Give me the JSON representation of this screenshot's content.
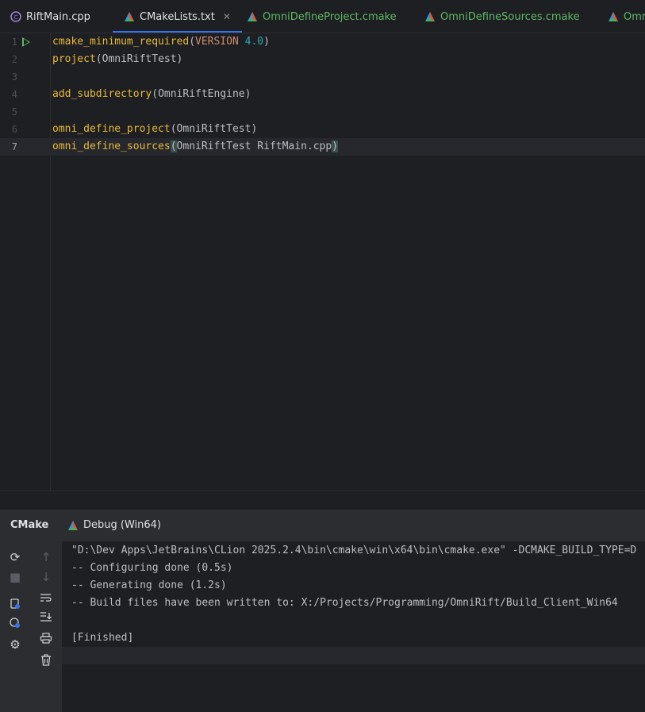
{
  "tabs": [
    {
      "label": "RiftMain.cpp",
      "icon": "cpp-file-icon",
      "active": false
    },
    {
      "label": "CMakeLists.txt",
      "icon": "cmake-file-icon",
      "active": true
    },
    {
      "label": "OmniDefineProject.cmake",
      "icon": "cmake-file-icon",
      "active": false
    },
    {
      "label": "OmniDefineSources.cmake",
      "icon": "cmake-file-icon",
      "active": false
    },
    {
      "label": "Omni",
      "icon": "cmake-file-icon",
      "active": false
    }
  ],
  "editor": {
    "lines": [
      {
        "num": "1",
        "fn": "cmake_minimum_required",
        "open": "(",
        "kw": "VERSION",
        "sp": " ",
        "num_val": "4.0",
        "arg": "",
        "close": ")"
      },
      {
        "num": "2",
        "fn": "project",
        "open": "(",
        "kw": "",
        "sp": "",
        "num_val": "",
        "arg": "OmniRiftTest",
        "close": ")"
      },
      {
        "num": "3"
      },
      {
        "num": "4",
        "fn": "add_subdirectory",
        "open": "(",
        "kw": "",
        "sp": "",
        "num_val": "",
        "arg": "OmniRiftEngine",
        "close": ")"
      },
      {
        "num": "5"
      },
      {
        "num": "6",
        "fn": "omni_define_project",
        "open": "(",
        "kw": "",
        "sp": "",
        "num_val": "",
        "arg": "OmniRiftTest",
        "close": ")"
      },
      {
        "num": "7",
        "fn": "omni_define_sources",
        "open": "(",
        "kw": "",
        "sp": "",
        "num_val": "",
        "arg": "OmniRiftTest RiftMain.cpp",
        "close": ")"
      }
    ]
  },
  "tool_window": {
    "title": "CMake",
    "tab_label": "Debug (Win64)",
    "console": [
      "\"D:\\Dev Apps\\JetBrains\\CLion 2025.2.4\\bin\\cmake\\win\\x64\\bin\\cmake.exe\" -DCMAKE_BUILD_TYPE=D",
      "-- Configuring done (0.5s)",
      "-- Generating done (1.2s)",
      "-- Build files have been written to: X:/Projects/Programming/OmniRift/Build_Client_Win64",
      "",
      "[Finished]"
    ]
  },
  "colors": {
    "accent": "#3574f0",
    "function": "#e8ba36",
    "keyword": "#cf8e6d",
    "number": "#2aacb8",
    "green": "#5fb865"
  }
}
